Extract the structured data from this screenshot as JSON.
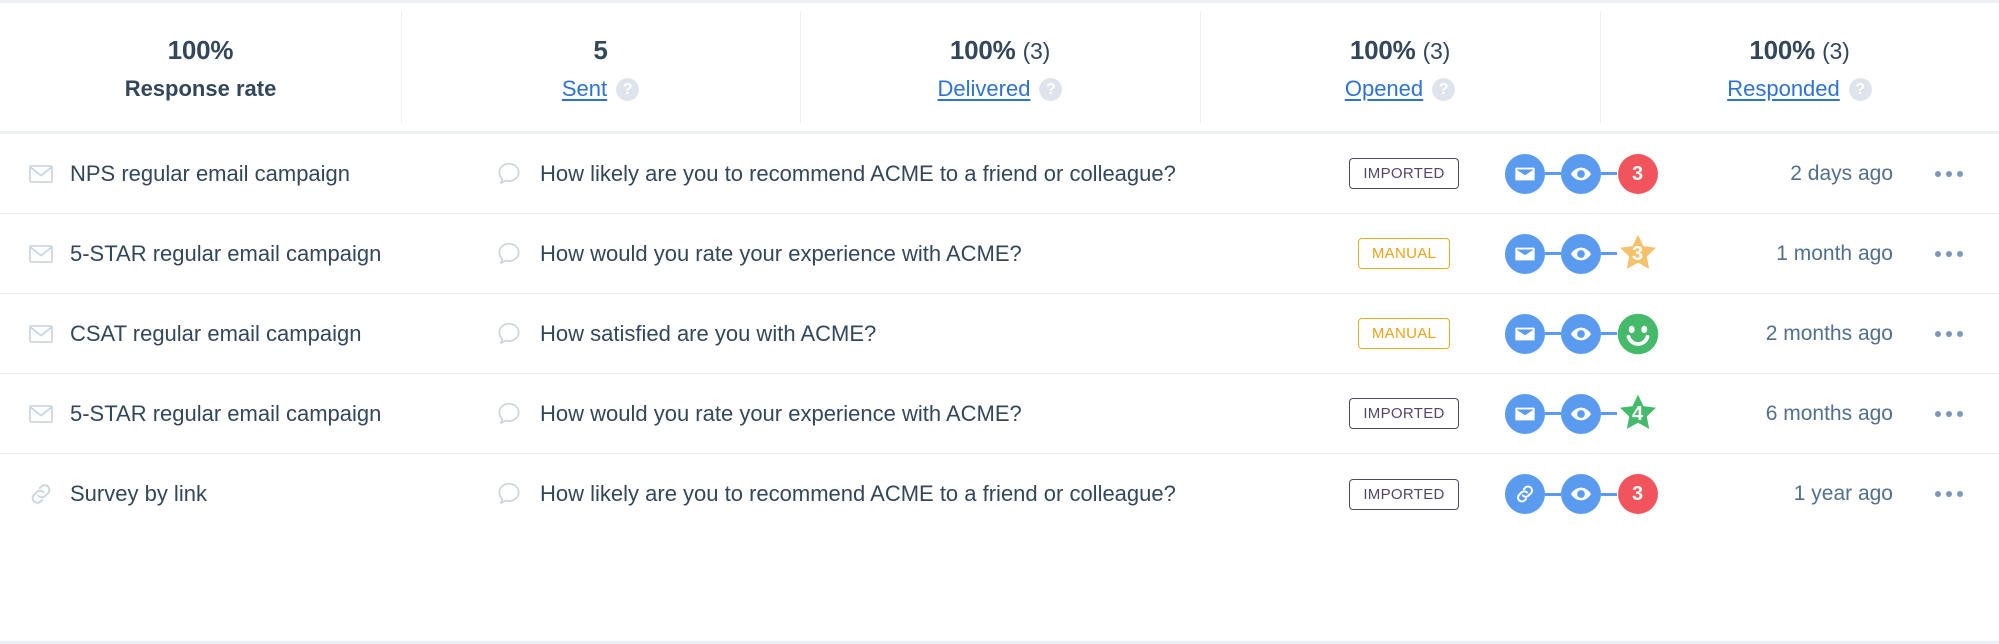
{
  "header": {
    "stats": [
      {
        "value": "100%",
        "count": "",
        "label": "Response rate",
        "is_link": false,
        "has_help": false
      },
      {
        "value": "5",
        "count": "",
        "label": "Sent",
        "is_link": true,
        "has_help": true
      },
      {
        "value": "100%",
        "count": "(3)",
        "label": "Delivered",
        "is_link": true,
        "has_help": true
      },
      {
        "value": "100%",
        "count": "(3)",
        "label": "Opened",
        "is_link": true,
        "has_help": true
      },
      {
        "value": "100%",
        "count": "(3)",
        "label": "Responded",
        "is_link": true,
        "has_help": true
      }
    ],
    "help_glyph": "?"
  },
  "rows": [
    {
      "type_icon": "envelope-icon",
      "name": "NPS regular email campaign",
      "question": "How likely are you to recommend ACME to a friend or colleague?",
      "badge": "IMPORTED",
      "badge_style": "imported",
      "pipeline": {
        "first_icon": "envelope-icon",
        "second_icon": "eye-icon",
        "result_shape": "circle",
        "result_color": "#f2545b",
        "result_value": "3"
      },
      "time": "2 days ago"
    },
    {
      "type_icon": "envelope-icon",
      "name": "5-STAR regular email campaign",
      "question": "How would you rate your experience with ACME?",
      "badge": "MANUAL",
      "badge_style": "manual",
      "pipeline": {
        "first_icon": "envelope-icon",
        "second_icon": "eye-icon",
        "result_shape": "star",
        "result_color": "#f5c26b",
        "result_value": "3"
      },
      "time": "1 month ago"
    },
    {
      "type_icon": "envelope-icon",
      "name": "CSAT regular email campaign",
      "question": "How satisfied are you with ACME?",
      "badge": "MANUAL",
      "badge_style": "manual",
      "pipeline": {
        "first_icon": "envelope-icon",
        "second_icon": "eye-icon",
        "result_shape": "smiley",
        "result_color": "#45ba6a",
        "result_value": ""
      },
      "time": "2 months ago"
    },
    {
      "type_icon": "envelope-icon",
      "name": "5-STAR regular email campaign",
      "question": "How would you rate your experience with ACME?",
      "badge": "IMPORTED",
      "badge_style": "imported",
      "pipeline": {
        "first_icon": "envelope-icon",
        "second_icon": "eye-icon",
        "result_shape": "star",
        "result_color": "#45ba6a",
        "result_value": "4"
      },
      "time": "6 months ago"
    },
    {
      "type_icon": "link-icon",
      "name": "Survey by link",
      "question": "How likely are you to recommend ACME to a friend or colleague?",
      "badge": "IMPORTED",
      "badge_style": "imported",
      "pipeline": {
        "first_icon": "link-icon",
        "second_icon": "eye-icon",
        "result_shape": "circle",
        "result_color": "#f2545b",
        "result_value": "3"
      },
      "time": "1 year ago"
    }
  ],
  "colors": {
    "text_primary": "#33475b",
    "text_muted": "#516f90",
    "link": "#2d72d9",
    "icon_muted": "#cbd6e2",
    "pipeline_blue": "#5a9bf0",
    "badge_imported": "#51476b",
    "badge_manual": "#e8a317",
    "border": "#eaf0f6"
  }
}
